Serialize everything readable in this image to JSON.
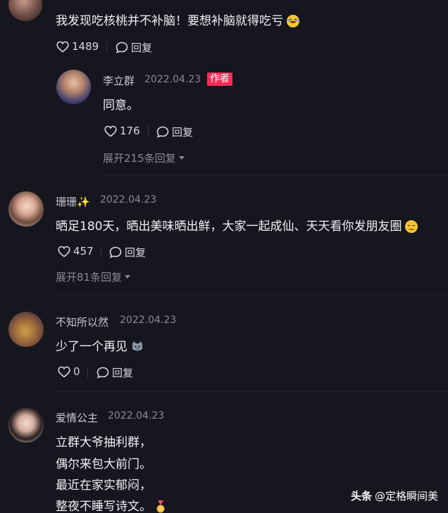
{
  "comments": [
    {
      "text": "我发现吃核桃并不补脑！要想补脑就得吃亏",
      "likes": "1489",
      "reply_label": "回复"
    },
    {
      "name": "李立群",
      "date": "2022.04.23",
      "badge": "作者",
      "text": "同意。",
      "likes": "176",
      "reply_label": "回复",
      "expand": "展开215条回复"
    },
    {
      "name": "珊珊✨",
      "date": "2022.04.23",
      "text": "晒足180天，晒出美味晒出鲜，大家一起成仙、天天看你发朋友圈",
      "likes": "457",
      "reply_label": "回复",
      "expand": "展开81条回复"
    },
    {
      "name": "不知所以然",
      "date": "2022.04.23",
      "text": "少了一个再见",
      "likes": "0",
      "reply_label": "回复"
    },
    {
      "name": "爱情公主",
      "date": "2022.04.23",
      "lines": [
        "立群大爷抽利群，",
        "偶尔来包大前门。",
        "最近在家实郁闷，",
        "整夜不睡写诗文。"
      ]
    }
  ],
  "watermark": {
    "brand": "头条",
    "handle": "@定格瞬间美"
  },
  "colors": {
    "background": "#16161e",
    "author_badge": "#fe2c55"
  }
}
